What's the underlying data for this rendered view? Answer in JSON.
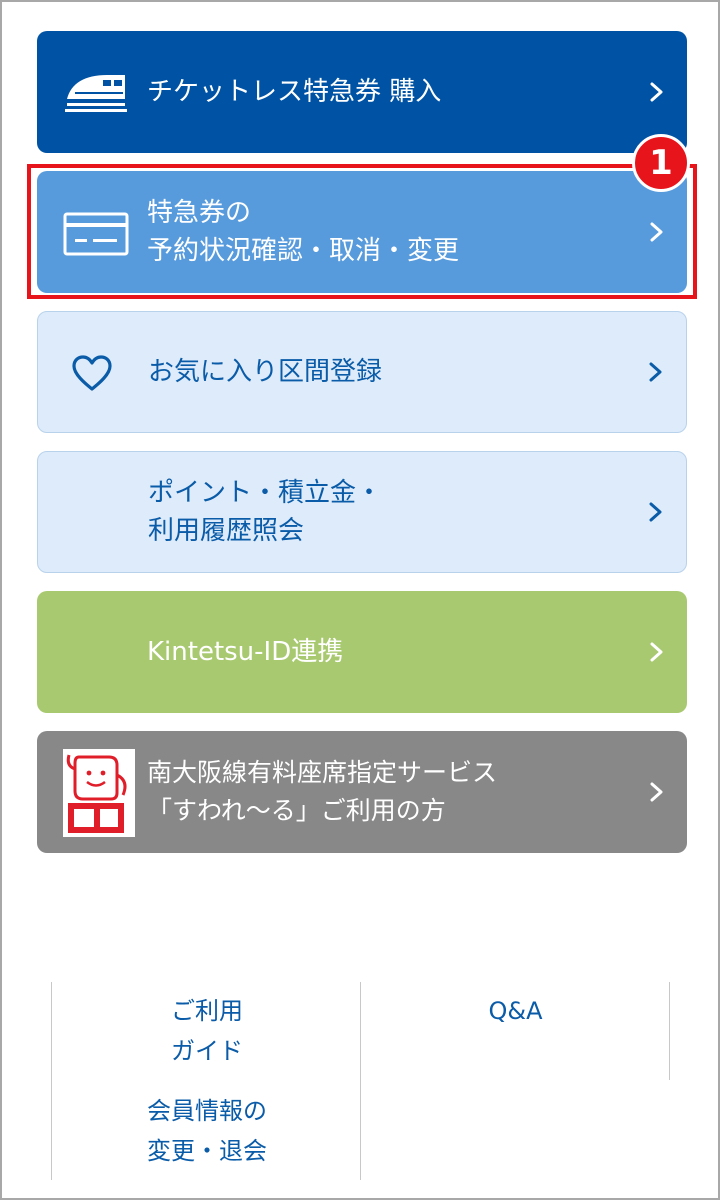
{
  "menu": {
    "ticketless": {
      "label": "チケットレス特急券 購入"
    },
    "reservation": {
      "line1": "特急券の",
      "line2": "予約状況確認・取消・変更"
    },
    "favorites": {
      "label": "お気に入り区間登録"
    },
    "points": {
      "line1": "ポイント・積立金・",
      "line2": "利用履歴照会"
    },
    "kintetsu_id": {
      "label": "Kintetsu-ID連携"
    },
    "suware": {
      "line1": "南大阪線有料座席指定サービス",
      "line2": "「すわれ〜る」ご利用の方"
    }
  },
  "step_badge": "1",
  "footer": {
    "guide": {
      "line1": "ご利用",
      "line2": "ガイド"
    },
    "qa": {
      "label": "Q&A"
    },
    "member": {
      "line1": "会員情報の",
      "line2": "変更・退会"
    }
  },
  "colors": {
    "primary": "#0053a4",
    "secondary": "#579bdd",
    "light": "#ddebfa",
    "green": "#a8c96f",
    "gray": "#888888",
    "highlight_red": "#e8141c",
    "link_blue": "#0a5ba8"
  },
  "icons": {
    "ticketless": "train-icon",
    "reservation": "ticket-card-icon",
    "favorites": "heart-icon",
    "suware": "suware-mascot-icon",
    "chevron": "chevron-right-icon"
  }
}
